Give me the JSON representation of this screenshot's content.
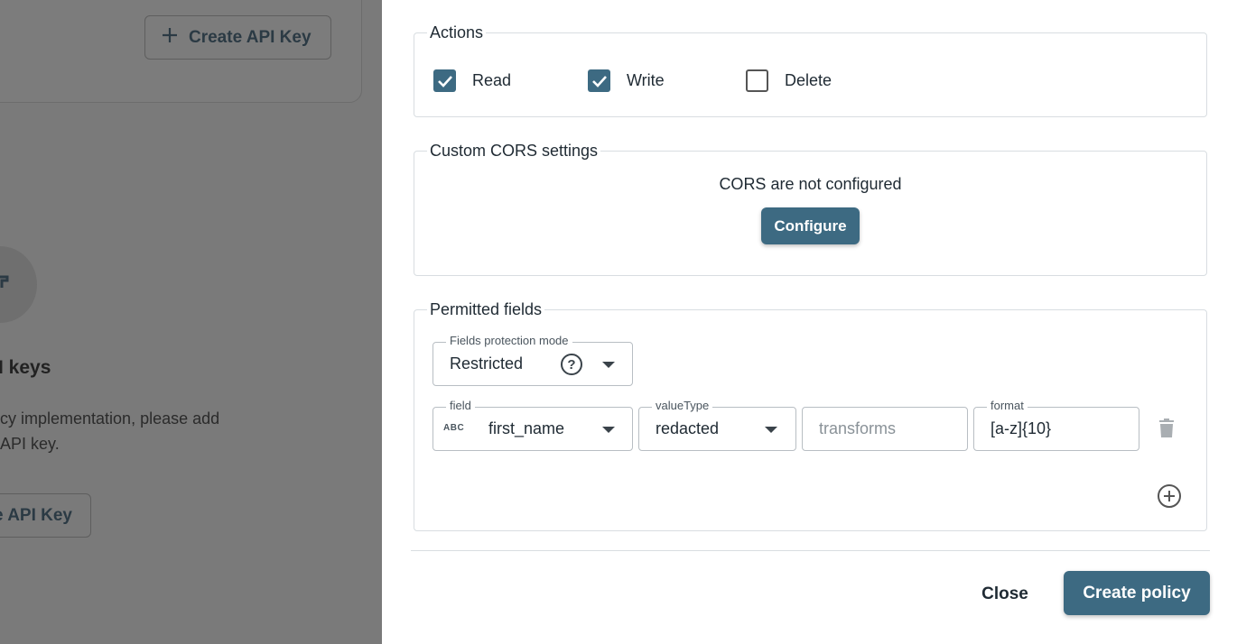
{
  "background": {
    "top_button_label": "Create API Key",
    "bottom_button_label": "e API Key",
    "title": "I keys",
    "text_line1": "cy implementation, please add",
    "text_line2": "API key."
  },
  "actions": {
    "legend": "Actions",
    "read": {
      "label": "Read",
      "checked": true
    },
    "write": {
      "label": "Write",
      "checked": true
    },
    "delete": {
      "label": "Delete",
      "checked": false
    }
  },
  "cors": {
    "legend": "Custom CORS settings",
    "status": "CORS are not configured",
    "configure_label": "Configure"
  },
  "permitted_fields": {
    "legend": "Permitted fields",
    "mode_label": "Fields protection mode",
    "mode_value": "Restricted",
    "row": {
      "field_label": "field",
      "field_type_badge": "ABC",
      "field_value": "first_name",
      "value_type_label": "valueType",
      "value_type_value": "redacted",
      "transforms_placeholder": "transforms",
      "format_label": "format",
      "format_value": "[a-z]{10}"
    }
  },
  "footer": {
    "close_label": "Close",
    "create_label": "Create policy"
  },
  "colors": {
    "primary": "#3d6a82",
    "overlay": "#7a7a7a"
  }
}
